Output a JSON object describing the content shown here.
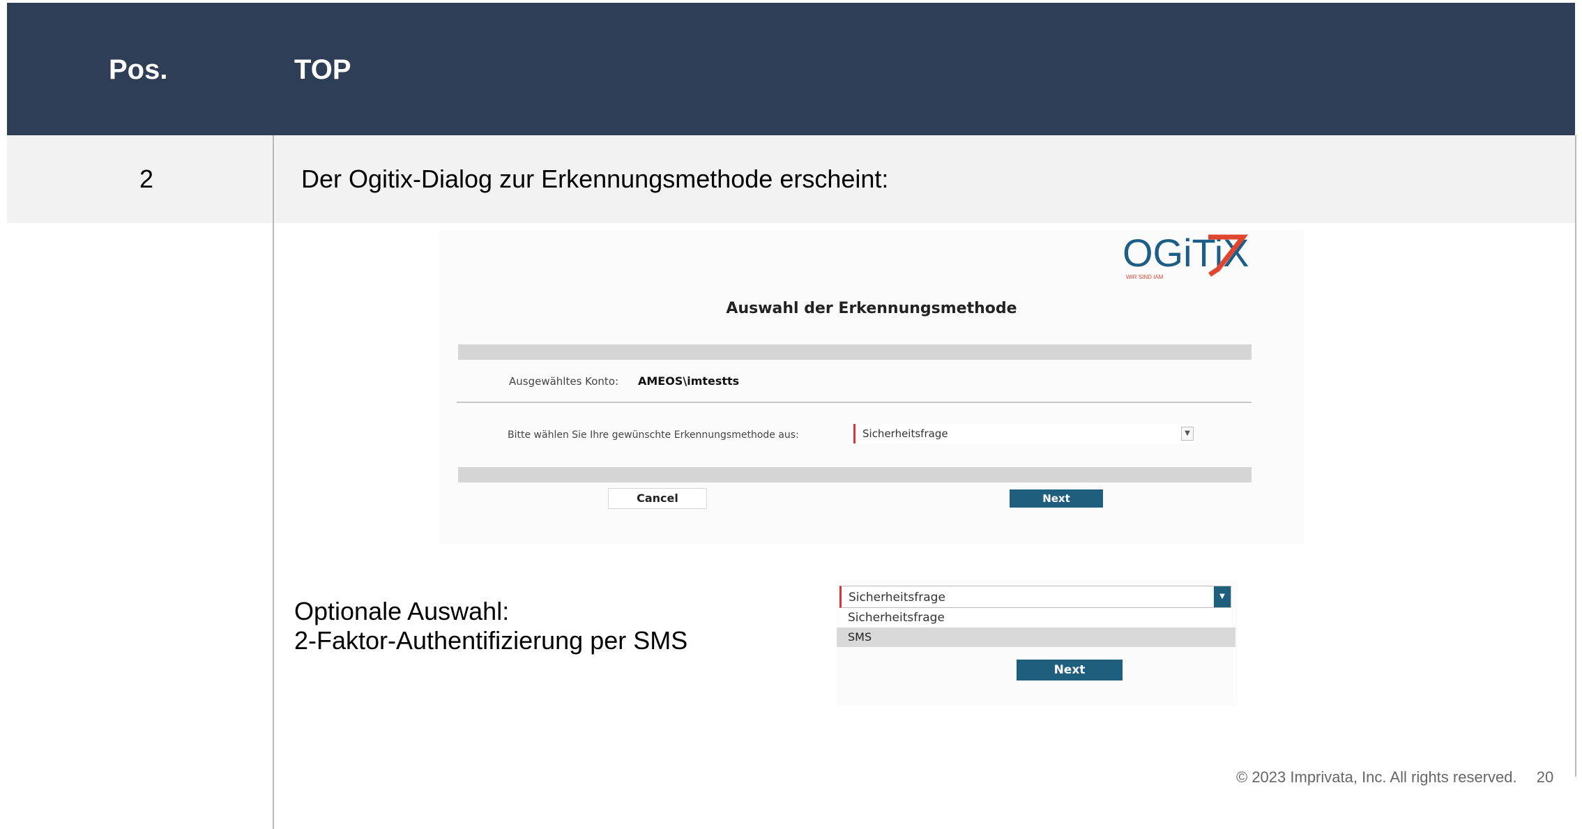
{
  "header": {
    "pos_label": "Pos.",
    "top_label": "TOP"
  },
  "row": {
    "number": "2",
    "text": "Der Ogitix-Dialog zur Erkennungsmethode erscheint:"
  },
  "dialog": {
    "logo_text": "OGiTiX",
    "logo_tagline": "WIR SIND IAM",
    "title": "Auswahl der Erkennungsmethode",
    "konto_label": "Ausgewähltes Konto:",
    "konto_value": "AMEOS\\imtestts",
    "method_label": "Bitte wählen Sie Ihre gewünschte Erkennungsmethode aus:",
    "method_selected": "Sicherheitsfrage",
    "cancel_label": "Cancel",
    "next_label": "Next"
  },
  "optional": {
    "line1": "Optionale Auswahl:",
    "line2": "2-Faktor-Authentifizierung per SMS"
  },
  "dropdown": {
    "selected": "Sicherheitsfrage",
    "options": [
      "Sicherheitsfrage",
      "SMS"
    ],
    "next_label": "Next"
  },
  "footer": {
    "copyright": "© 2023 Imprivata, Inc. All rights reserved.",
    "page_number": "20"
  },
  "colors": {
    "header_bg": "#2e3e57",
    "button_bg": "#1f5f7e",
    "accent_red": "#dd3333",
    "logo_blue": "#1c5e85"
  }
}
